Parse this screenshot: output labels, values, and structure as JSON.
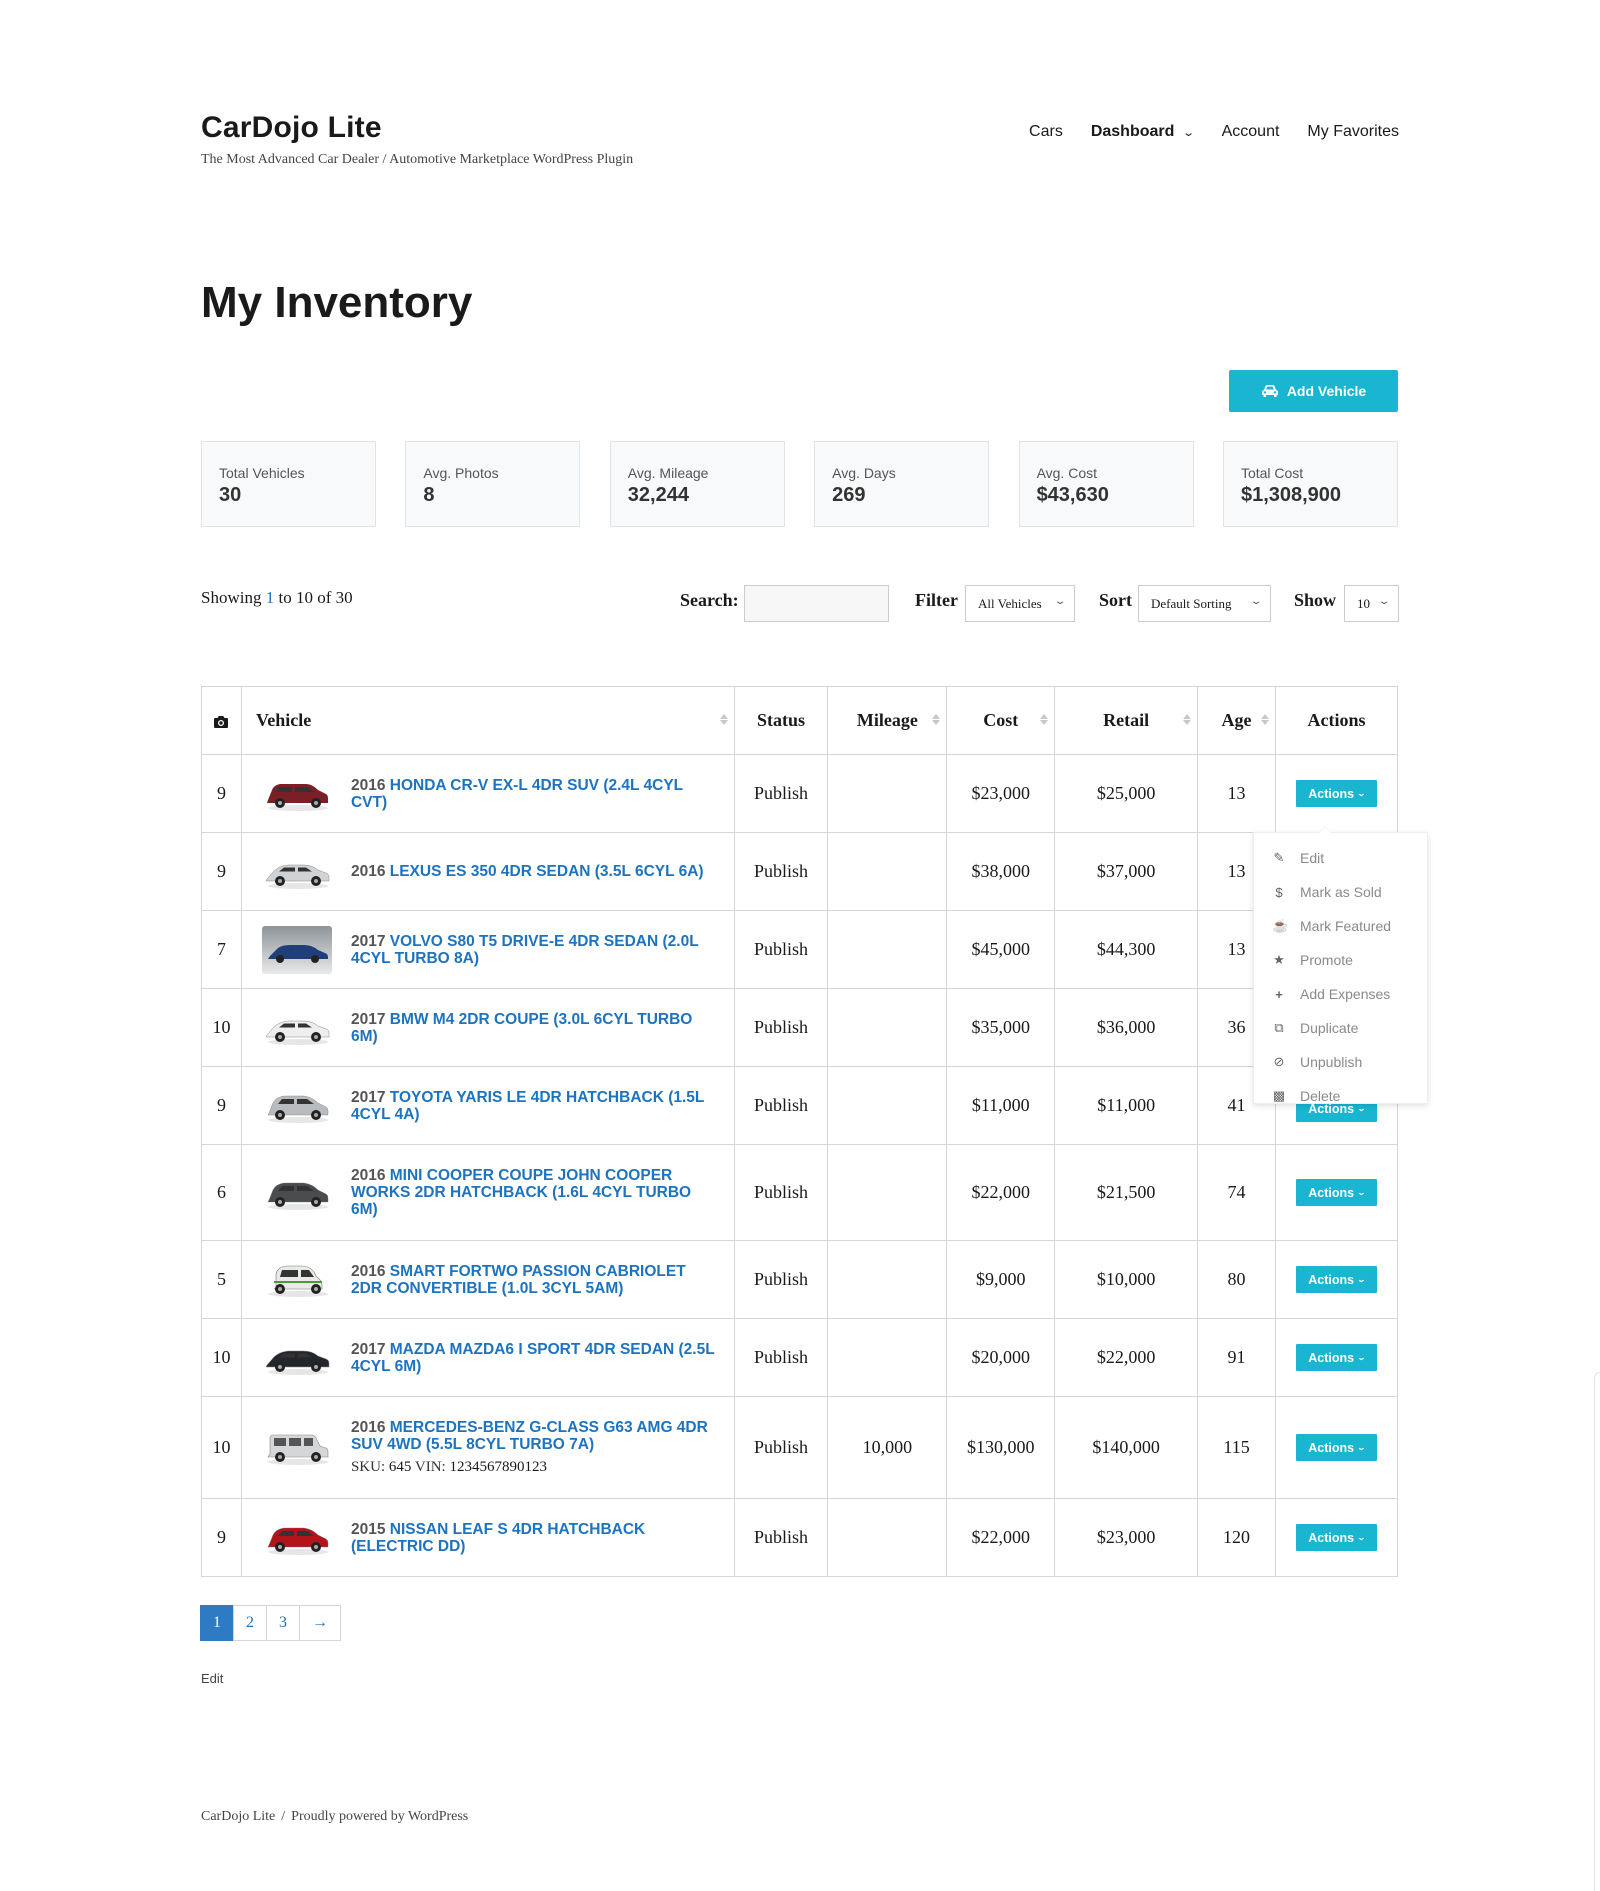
{
  "site": {
    "title": "CarDojo Lite",
    "tagline": "The Most Advanced Car Dealer / Automotive Marketplace WordPress Plugin"
  },
  "nav": {
    "items": [
      {
        "label": "Cars",
        "active": false
      },
      {
        "label": "Dashboard",
        "active": true,
        "has_dropdown": true
      },
      {
        "label": "Account",
        "active": false
      },
      {
        "label": "My Favorites",
        "active": false
      }
    ]
  },
  "page": {
    "title": "My Inventory",
    "add_button": "Add Vehicle"
  },
  "stats": [
    {
      "label": "Total Vehicles",
      "value": "30"
    },
    {
      "label": "Avg. Photos",
      "value": "8"
    },
    {
      "label": "Avg. Mileage",
      "value": "32,244"
    },
    {
      "label": "Avg. Days",
      "value": "269"
    },
    {
      "label": "Avg. Cost",
      "value": "$43,630"
    },
    {
      "label": "Total Cost",
      "value": "$1,308,900"
    }
  ],
  "listing": {
    "showing_prefix": "Showing",
    "from": "1",
    "to_word": "to",
    "to": "10",
    "of_word": "of",
    "total": "30"
  },
  "controls": {
    "search_label": "Search:",
    "search_value": "",
    "filter_label": "Filter",
    "filter_value": "All Vehicles",
    "sort_label": "Sort",
    "sort_value": "Default Sorting",
    "show_label": "Show",
    "show_value": "10"
  },
  "table": {
    "headers": {
      "photos_icon": "camera-icon",
      "vehicle": "Vehicle",
      "status": "Status",
      "mileage": "Mileage",
      "cost": "Cost",
      "retail": "Retail",
      "age": "Age",
      "actions": "Actions"
    },
    "action_label": "Actions",
    "rows": [
      {
        "photos": "9",
        "year": "2016",
        "name": "Honda CR-V EX-L 4dr SUV (2.4L 4cyl CVT)",
        "sku": "",
        "vin": "",
        "status": "Publish",
        "mileage": "",
        "cost": "$23,000",
        "retail": "$25,000",
        "age": "13",
        "car_color": "#7a1f25",
        "car_style": "suv"
      },
      {
        "photos": "9",
        "year": "2016",
        "name": "Lexus ES 350 4dr Sedan (3.5L 6cyl 6A)",
        "sku": "",
        "vin": "",
        "status": "Publish",
        "mileage": "",
        "cost": "$38,000",
        "retail": "$37,000",
        "age": "13",
        "car_color": "#cfd3d6",
        "car_style": "sedan"
      },
      {
        "photos": "7",
        "year": "2017",
        "name": "Volvo S80 T5 Drive-E 4dr Sedan (2.0L 4cyl Turbo 8A)",
        "sku": "",
        "vin": "",
        "status": "Publish",
        "mileage": "",
        "cost": "$45,000",
        "retail": "$44,300",
        "age": "13",
        "car_color": "#1f3f7a",
        "car_style": "photo"
      },
      {
        "photos": "10",
        "year": "2017",
        "name": "BMW M4 2dr Coupe (3.0L 6cyl Turbo 6M)",
        "sku": "",
        "vin": "",
        "status": "Publish",
        "mileage": "",
        "cost": "$35,000",
        "retail": "$36,000",
        "age": "36",
        "car_color": "#eeeeee",
        "car_style": "coupe"
      },
      {
        "photos": "9",
        "year": "2017",
        "name": "Toyota Yaris LE 4dr Hatchback (1.5L 4cyl 4A)",
        "sku": "",
        "vin": "",
        "status": "Publish",
        "mileage": "",
        "cost": "$11,000",
        "retail": "$11,000",
        "age": "41",
        "car_color": "#b9bcbf",
        "car_style": "hatch"
      },
      {
        "photos": "6",
        "year": "2016",
        "name": "MINI Cooper Coupe John Cooper Works 2dr Hatchback (1.6L 4cyl Turbo 6M)",
        "sku": "",
        "vin": "",
        "status": "Publish",
        "mileage": "",
        "cost": "$22,000",
        "retail": "$21,500",
        "age": "74",
        "car_color": "#4a4d4f",
        "car_style": "hatch"
      },
      {
        "photos": "5",
        "year": "2016",
        "name": "smart fortwo passion Cabriolet 2dr Convertible (1.0L 3cyl 5AM)",
        "sku": "",
        "vin": "",
        "status": "Publish",
        "mileage": "",
        "cost": "$9,000",
        "retail": "$10,000",
        "age": "80",
        "car_color": "#e9ece6",
        "car_style": "smart"
      },
      {
        "photos": "10",
        "year": "2017",
        "name": "Mazda MAZDA6 i Sport 4dr Sedan (2.5L 4cyl 6M)",
        "sku": "",
        "vin": "",
        "status": "Publish",
        "mileage": "",
        "cost": "$20,000",
        "retail": "$22,000",
        "age": "91",
        "car_color": "#23262b",
        "car_style": "sedan"
      },
      {
        "photos": "10",
        "year": "2016",
        "name": "Mercedes-Benz G-Class G63 AMG 4dr SUV 4WD (5.5L 8cyl Turbo 7A)",
        "sku": "645",
        "vin": "1234567890123",
        "sku_label": "SKU:",
        "vin_label": "VIN:",
        "status": "Publish",
        "mileage": "10,000",
        "cost": "$130,000",
        "retail": "$140,000",
        "age": "115",
        "car_color": "#d4d6d8",
        "car_style": "box"
      },
      {
        "photos": "9",
        "year": "2015",
        "name": "Nissan LEAF S 4dr Hatchback (Electric DD)",
        "sku": "",
        "vin": "",
        "status": "Publish",
        "mileage": "",
        "cost": "$22,000",
        "retail": "$23,000",
        "age": "120",
        "car_color": "#b3141c",
        "car_style": "hatch"
      }
    ]
  },
  "actions_menu": {
    "open_on_row": 0,
    "items": [
      {
        "label": "Edit",
        "icon": "pencil-icon"
      },
      {
        "label": "Mark as Sold",
        "icon": "dollar-icon"
      },
      {
        "label": "Mark Featured",
        "icon": "trophy-icon"
      },
      {
        "label": "Promote",
        "icon": "star-icon"
      },
      {
        "label": "Add Expenses",
        "icon": "plus-icon"
      },
      {
        "label": "Duplicate",
        "icon": "copy-icon"
      },
      {
        "label": "Unpublish",
        "icon": "eye-slash-icon"
      },
      {
        "label": "Delete",
        "icon": "trash-icon"
      }
    ]
  },
  "pagination": {
    "pages": [
      "1",
      "2",
      "3"
    ],
    "current": "1",
    "next": "→"
  },
  "edit_link": "Edit",
  "footer": {
    "site": "CarDojo Lite",
    "separator": "/",
    "powered": "Proudly powered by WordPress"
  },
  "colors": {
    "accent": "#1ab5d1",
    "link": "#1e73be",
    "pager_active": "#2e7bc4"
  }
}
